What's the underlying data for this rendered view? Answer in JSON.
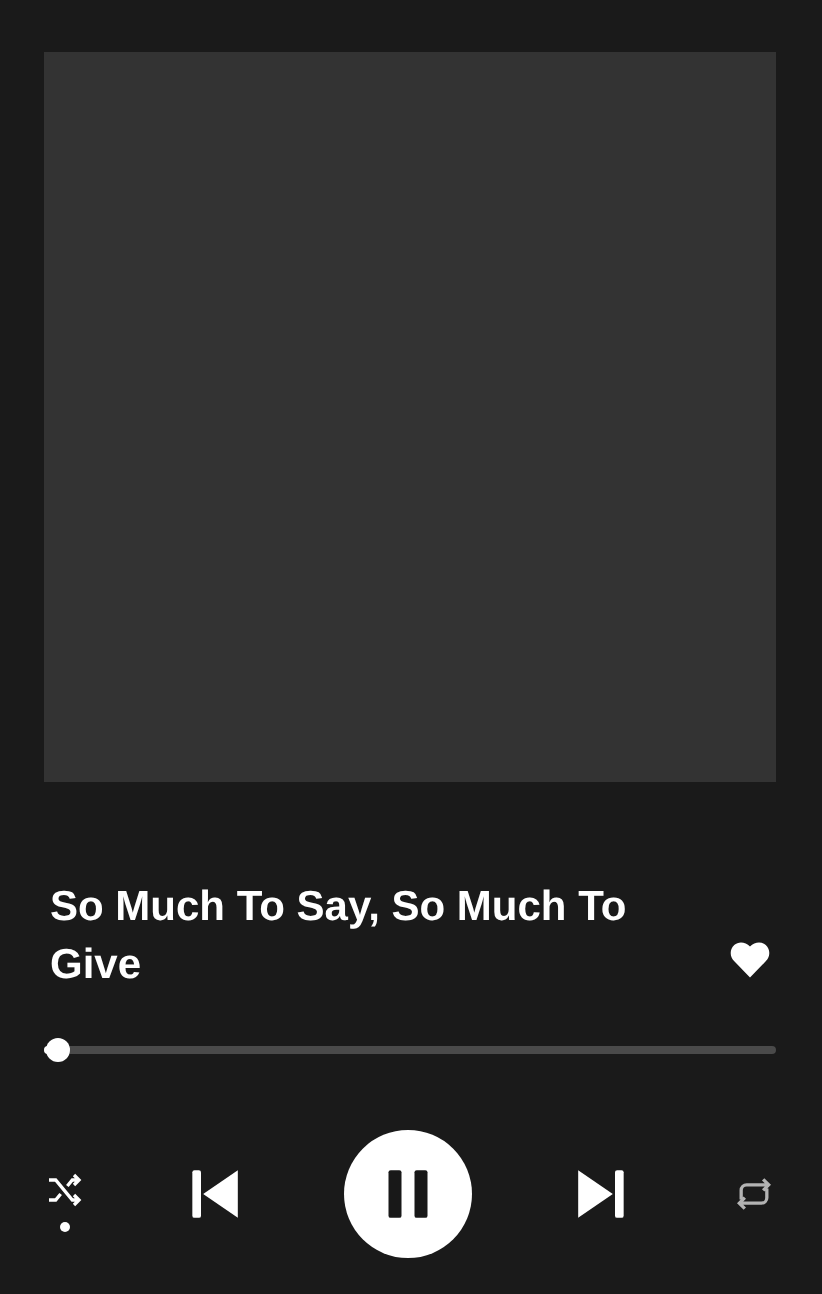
{
  "track": {
    "title": "So Much To Say, So Much To Give",
    "liked": true
  },
  "progress": {
    "level": 0.02
  },
  "controls": {
    "shuffle": true,
    "repeat": false,
    "playing": true
  }
}
